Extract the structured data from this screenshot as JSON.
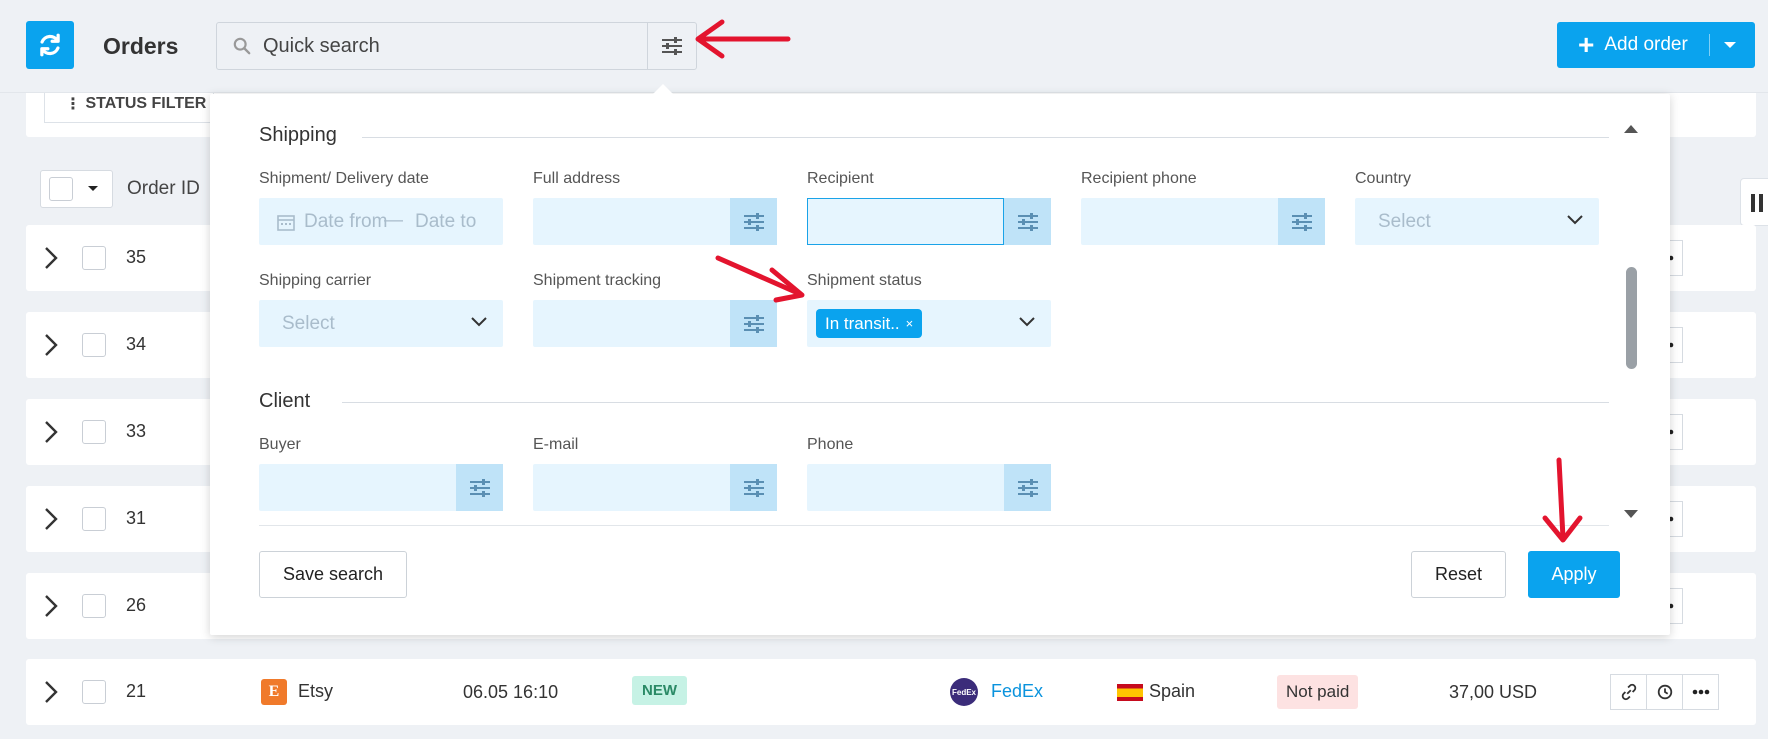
{
  "header": {
    "title": "Orders",
    "search_placeholder": "Quick search",
    "add_order_label": "Add order"
  },
  "list": {
    "status_filter_label": "STATUS FILTER",
    "order_id_header": "Order ID",
    "rows": [
      {
        "id": "35"
      },
      {
        "id": "34"
      },
      {
        "id": "33"
      },
      {
        "id": "31"
      },
      {
        "id": "26"
      },
      {
        "id": "21",
        "store": "Etsy",
        "store_icon_letter": "E",
        "date": "06.05 16:10",
        "status_badge": "NEW",
        "carrier": "FedEx",
        "carrier_icon_text": "FedEx",
        "country": "Spain",
        "payment": "Not paid",
        "total": "37,00 USD"
      }
    ]
  },
  "panel": {
    "shipping": {
      "title": "Shipping",
      "fields": {
        "delivery_date_label": "Shipment/ Delivery date",
        "date_from_placeholder": "Date from",
        "date_separator": "—",
        "date_to_placeholder": "Date to",
        "full_address_label": "Full address",
        "recipient_label": "Recipient",
        "recipient_phone_label": "Recipient phone",
        "country_label": "Country",
        "country_placeholder": "Select",
        "shipping_carrier_label": "Shipping carrier",
        "shipping_carrier_placeholder": "Select",
        "shipment_tracking_label": "Shipment tracking",
        "shipment_status_label": "Shipment status",
        "shipment_status_tag": "In transit..",
        "tag_remove": "×"
      }
    },
    "client": {
      "title": "Client",
      "fields": {
        "buyer_label": "Buyer",
        "email_label": "E-mail",
        "phone_label": "Phone"
      }
    },
    "buttons": {
      "save_search": "Save search",
      "reset": "Reset",
      "apply": "Apply"
    }
  },
  "colors": {
    "accent": "#0aa3ee",
    "field_bg": "#e6f5fe",
    "annotation_arrow": "#e3142e"
  },
  "icons": [
    "refresh-icon",
    "search-icon",
    "sliders-icon",
    "plus-icon",
    "chevron-down-icon",
    "calendar-icon",
    "chevron-right-icon",
    "link-icon",
    "history-icon",
    "more-icon"
  ]
}
